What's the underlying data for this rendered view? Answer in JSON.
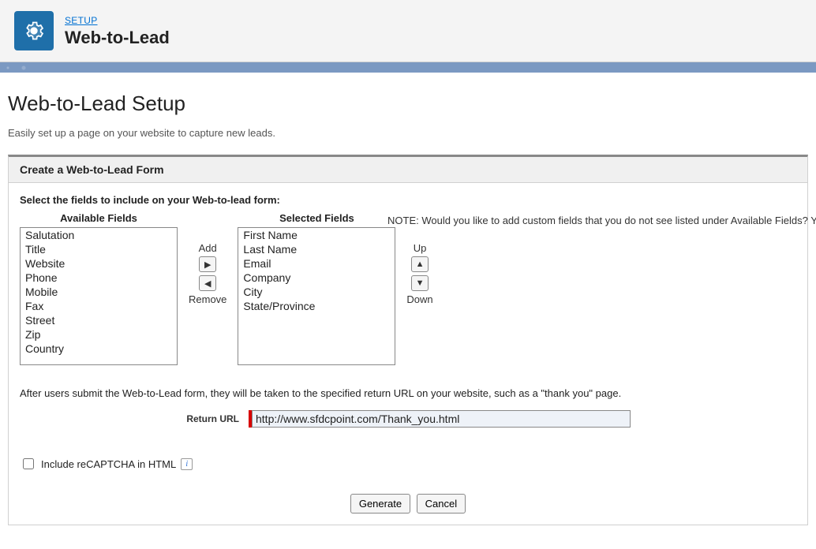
{
  "header": {
    "setup_link": "SETUP",
    "heading": "Web-to-Lead"
  },
  "page": {
    "title": "Web-to-Lead Setup",
    "description": "Easily set up a page on your website to capture new leads."
  },
  "panel": {
    "title": "Create a Web-to-Lead Form",
    "instructions": "Select the fields to include on your Web-to-lead form:",
    "note": "NOTE: Would you like to add custom fields that you do not see listed under Available Fields? You c",
    "available_label": "Available Fields",
    "selected_label": "Selected Fields",
    "available_fields": [
      "Salutation",
      "Title",
      "Website",
      "Phone",
      "Mobile",
      "Fax",
      "Street",
      "Zip",
      "Country"
    ],
    "selected_fields": [
      "First Name",
      "Last Name",
      "Email",
      "Company",
      "City",
      "State/Province"
    ],
    "add_label": "Add",
    "remove_label": "Remove",
    "up_label": "Up",
    "down_label": "Down"
  },
  "return": {
    "description": "After users submit the Web-to-Lead form, they will be taken to the specified return URL on your website, such as a \"thank you\" page.",
    "label": "Return URL",
    "value": "http://www.sfdcpoint.com/Thank_you.html"
  },
  "recaptcha": {
    "label": "Include reCAPTCHA in HTML",
    "checked": false
  },
  "buttons": {
    "generate": "Generate",
    "cancel": "Cancel"
  }
}
